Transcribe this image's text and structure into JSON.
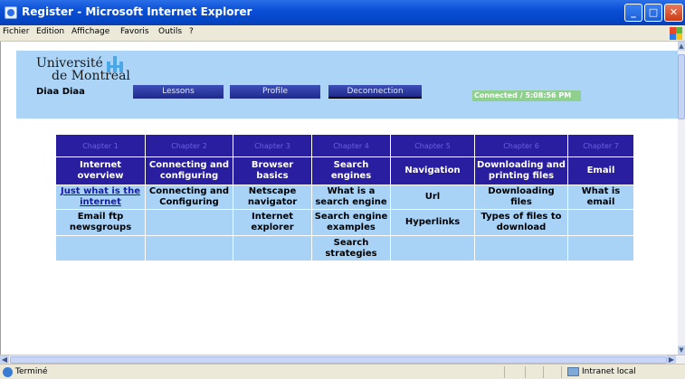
{
  "window": {
    "title": "Register - Microsoft Internet Explorer",
    "buttons": {
      "minimize": "_",
      "maximize": "□",
      "close": "✕"
    }
  },
  "menu": [
    "Fichier",
    "Edition",
    "Affichage",
    "Favoris",
    "Outils",
    "?"
  ],
  "header": {
    "logo_line1": "Université",
    "logo_line2": "de Montréal",
    "user": "Diaa Diaa",
    "tabs": [
      "Lessons",
      "Profile",
      "Deconnection"
    ],
    "status": "Connected / 5:08:56 PM"
  },
  "table": {
    "chapters": [
      "Chapter 1",
      "Chapter 2",
      "Chapter 3",
      "Chapter 4",
      "Chapter 5",
      "Chapter 6",
      "Chapter 7"
    ],
    "titles": [
      "Internet overview",
      "Connecting and configuring",
      "Browser basics",
      "Search engines",
      "Navigation",
      "Downloading and printing files",
      "Email"
    ],
    "rows": [
      [
        "Just what is the internet",
        "Connecting and Configuring",
        "Netscape navigator",
        "What is a search engine",
        "Url",
        "Downloading files",
        "What is email"
      ],
      [
        "Email ftp newsgroups",
        "",
        "Internet explorer",
        "Search engine examples",
        "Hyperlinks",
        "Types of files to download",
        ""
      ],
      [
        "",
        "",
        "",
        "Search strategies",
        "",
        "",
        ""
      ]
    ]
  },
  "statusbar": {
    "text": "Terminé",
    "zone": "Intranet local"
  },
  "colors": {
    "header_band": "#acd4f6",
    "table_header": "#2a1ea0",
    "table_cell": "#a8d3f7",
    "status_pill": "#8fd08f",
    "titlebar": "#0a4fd6"
  },
  "icons": {
    "title": "ie-page-icon",
    "logo": "udem-logo-icon",
    "windows_logo": "windows-logo-icon",
    "status": "ie-status-icon",
    "zone": "intranet-zone-icon"
  }
}
